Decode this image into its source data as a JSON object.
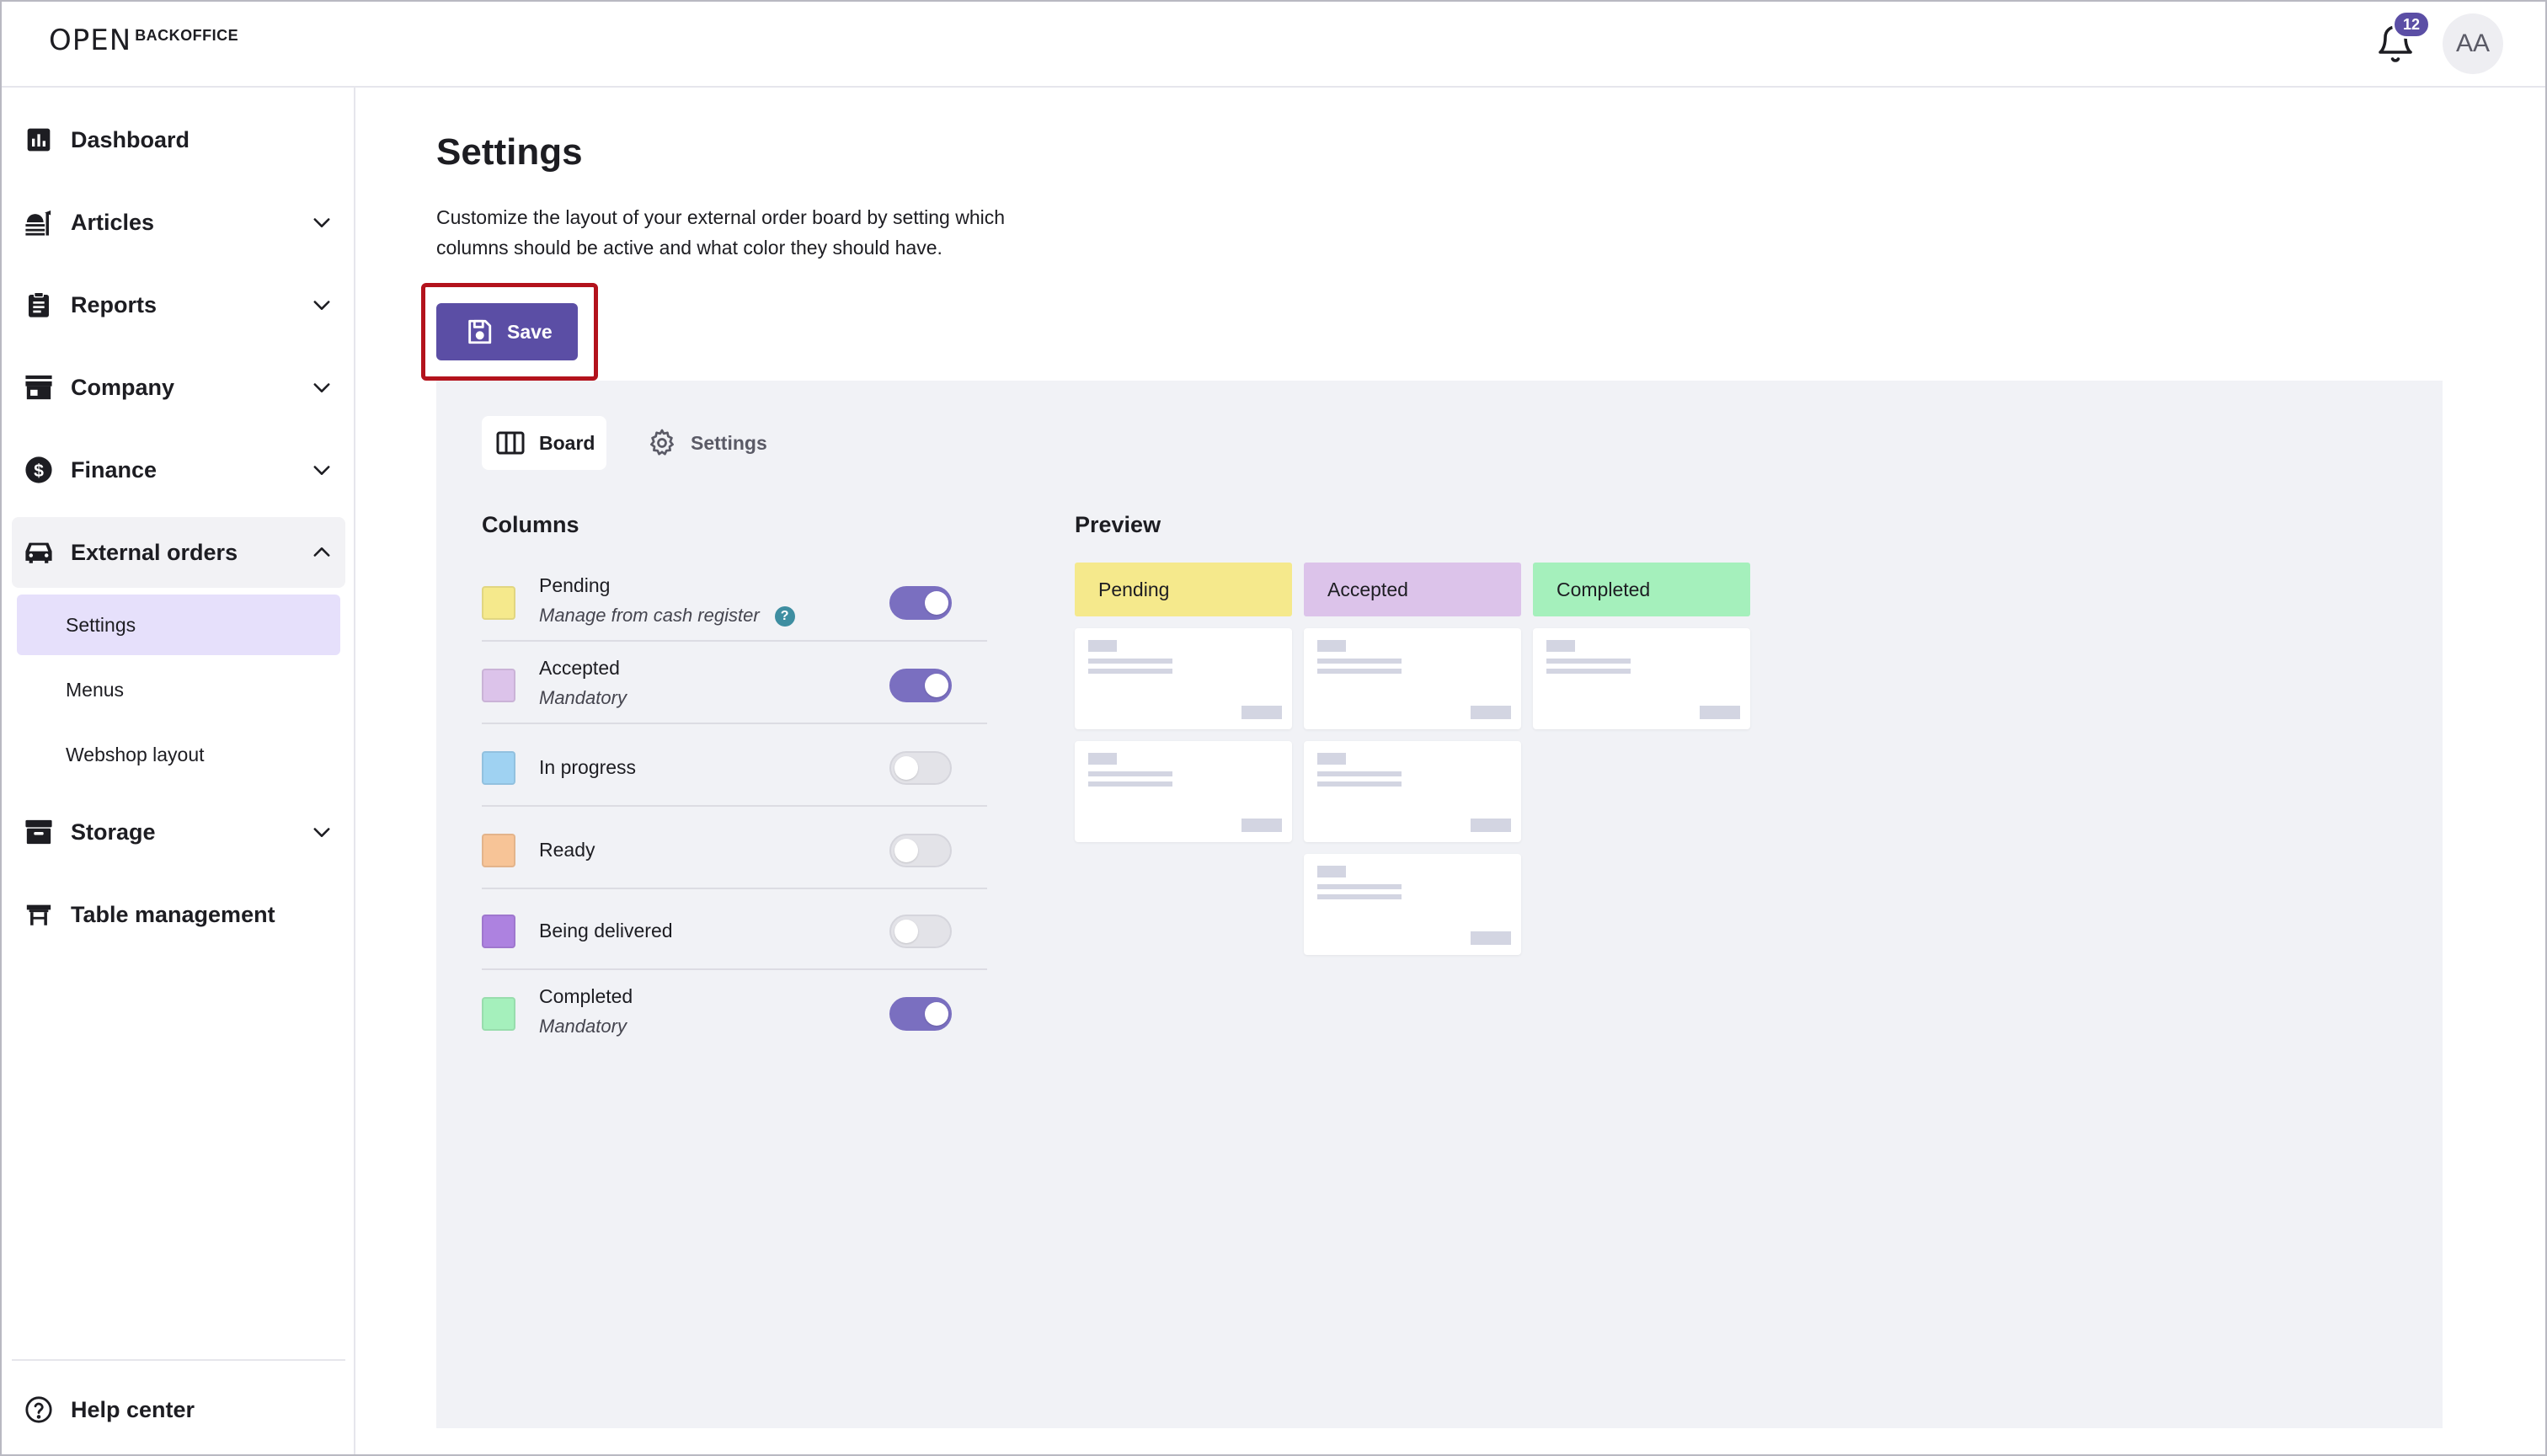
{
  "header": {
    "logo_mark": "OPEN",
    "logo_text": "BACKOFFICE",
    "notification_count": "12",
    "avatar_initials": "AA"
  },
  "sidebar": {
    "items": [
      {
        "label": "Dashboard",
        "icon": "dashboard-icon",
        "expandable": false
      },
      {
        "label": "Articles",
        "icon": "articles-icon",
        "expandable": true
      },
      {
        "label": "Reports",
        "icon": "reports-icon",
        "expandable": true
      },
      {
        "label": "Company",
        "icon": "company-icon",
        "expandable": true
      },
      {
        "label": "Finance",
        "icon": "finance-icon",
        "expandable": true
      },
      {
        "label": "External orders",
        "icon": "external-orders-icon",
        "expandable": true,
        "expanded": true
      },
      {
        "label": "Storage",
        "icon": "storage-icon",
        "expandable": true
      },
      {
        "label": "Table management",
        "icon": "table-management-icon",
        "expandable": false
      }
    ],
    "sub_items": [
      {
        "label": "Settings",
        "selected": true
      },
      {
        "label": "Menus",
        "selected": false
      },
      {
        "label": "Webshop layout",
        "selected": false
      }
    ],
    "help_label": "Help center"
  },
  "main": {
    "title": "Settings",
    "description": "Customize the layout of your external order board by setting which columns should be active and what color they should have.",
    "save_label": "Save",
    "tabs": [
      {
        "label": "Board",
        "active": true
      },
      {
        "label": "Settings",
        "active": false
      }
    ],
    "columns_title": "Columns",
    "preview_title": "Preview",
    "columns": [
      {
        "name": "Pending",
        "sub": "Manage from cash register",
        "help": "?",
        "color": "#f5e98c",
        "enabled": true
      },
      {
        "name": "Accepted",
        "sub": "Mandatory",
        "color": "#dcc3ea",
        "enabled": true
      },
      {
        "name": "In progress",
        "sub": "",
        "color": "#9fd2f2",
        "enabled": false
      },
      {
        "name": "Ready",
        "sub": "",
        "color": "#f7c497",
        "enabled": false
      },
      {
        "name": "Being delivered",
        "sub": "",
        "color": "#ad82e0",
        "enabled": false
      },
      {
        "name": "Completed",
        "sub": "Mandatory",
        "color": "#a5f0bc",
        "enabled": true
      }
    ],
    "preview": [
      {
        "label": "Pending",
        "color": "#f5e98c",
        "cards": 2
      },
      {
        "label": "Accepted",
        "color": "#dcc3ea",
        "cards": 3
      },
      {
        "label": "Completed",
        "color": "#a5f0bc",
        "cards": 1
      }
    ]
  },
  "colors": {
    "primary": "#5b4ea5",
    "toggle_on": "#7a6fc0",
    "selected_bg": "#e6e0fb",
    "panel_bg": "#f1f2f6",
    "highlight": "#b3121c"
  }
}
